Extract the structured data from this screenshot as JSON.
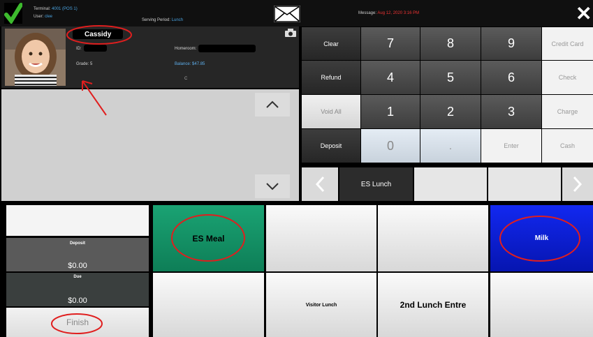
{
  "header": {
    "terminal_label": "Terminal:",
    "terminal_value": "4001 (POS 1)",
    "user_label": "User:",
    "user_value": "clee",
    "serving_label": "Serving Period:",
    "serving_value": "Lunch",
    "message_label": "Message:",
    "message_value": "Aug 12, 2020 3:16 PM"
  },
  "student": {
    "name": "Cassidy",
    "id_label": "ID:",
    "homeroom_label": "Homeroom:",
    "grade": "Grade: 5",
    "balance": "Balance: $47.85",
    "code": "C"
  },
  "keypad": {
    "clear": "Clear",
    "refund": "Refund",
    "void_all": "Void All",
    "deposit": "Deposit",
    "k7": "7",
    "k8": "8",
    "k9": "9",
    "k4": "4",
    "k5": "5",
    "k6": "6",
    "k1": "1",
    "k2": "2",
    "k3": "3",
    "k0": "0",
    "dot": ".",
    "enter": "Enter",
    "credit_card": "Credit Card",
    "check": "Check",
    "charge": "Charge",
    "cash": "Cash"
  },
  "category_tab": "ES Lunch",
  "summary": {
    "deposit_label": "Deposit",
    "deposit_value": "$0.00",
    "due_label": "Due",
    "due_value": "$0.00",
    "finish": "Finish"
  },
  "items": {
    "es_meal": "ES Meal",
    "milk": "Milk",
    "visitor_lunch": "Visitor Lunch",
    "second_lunch": "2nd Lunch Entre"
  },
  "colors": {
    "green_tile": "#139668",
    "blue_tile": "#0a1fd6",
    "annotation_red": "#e01e1e"
  }
}
